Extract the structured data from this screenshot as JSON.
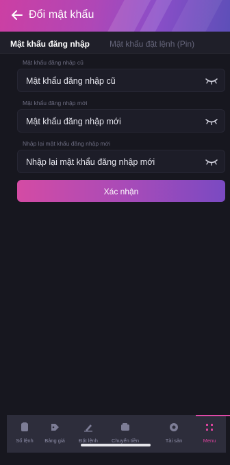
{
  "header": {
    "title": "Đổi mật khẩu",
    "gradient": [
      "#cc3fa3",
      "#8a4ec8",
      "#5d4fb8"
    ]
  },
  "tabs": [
    {
      "label": "Mật khẩu đăng nhập",
      "active": true
    },
    {
      "label": "Mật khẩu đặt lệnh (Pin)",
      "active": false
    }
  ],
  "fields": [
    {
      "label": "Mật khẩu đăng nhập cũ",
      "placeholder": "Mật khẩu đăng nhập cũ",
      "icon": "eye-closed-icon"
    },
    {
      "label": "Mật khẩu đăng nhập mới",
      "placeholder": "Mật khẩu đăng nhập mới",
      "icon": "eye-closed-icon"
    },
    {
      "label": "Nhập lại mật khẩu đăng nhập mới",
      "placeholder": "Nhập lại mật khẩu đăng nhập mới",
      "icon": "eye-closed-icon"
    }
  ],
  "submit": {
    "label": "Xác nhận"
  },
  "bottom_nav": [
    {
      "label": "Sổ lệnh",
      "icon": "order-book-icon",
      "active": false
    },
    {
      "label": "Bảng giá",
      "icon": "price-board-icon",
      "active": false
    },
    {
      "label": "Đặt lệnh",
      "icon": "place-order-icon",
      "active": false
    },
    {
      "label": "Chuyển tiền",
      "icon": "transfer-icon",
      "active": false
    },
    {
      "label": "Tài sản",
      "icon": "assets-icon",
      "active": false
    },
    {
      "label": "Menu",
      "icon": "menu-grid-icon",
      "active": true
    }
  ],
  "colors": {
    "background": "#17171f",
    "accent": "#d8439c",
    "nav_background": "#2d2d3b"
  }
}
